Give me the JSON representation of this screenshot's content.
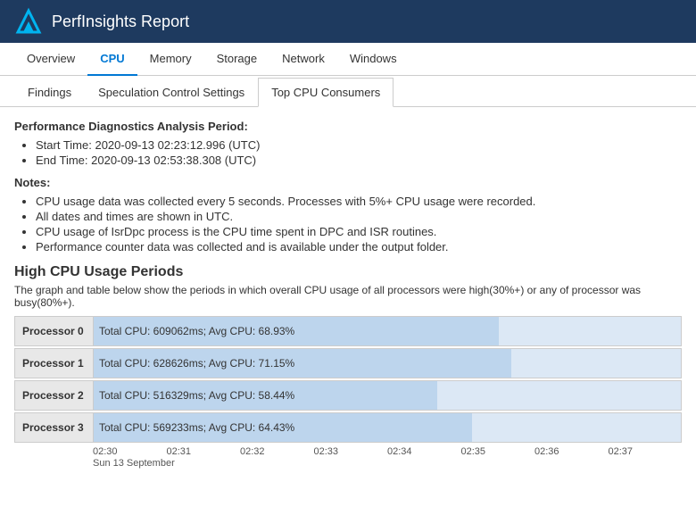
{
  "header": {
    "title": "PerfInsights Report"
  },
  "tabs1": {
    "items": [
      "Overview",
      "CPU",
      "Memory",
      "Storage",
      "Network",
      "Windows"
    ],
    "active": "CPU"
  },
  "tabs2": {
    "items": [
      "Findings",
      "Speculation Control Settings",
      "Top CPU Consumers"
    ],
    "active": "Top CPU Consumers"
  },
  "analysis_period": {
    "label": "Performance Diagnostics Analysis Period:",
    "start": "Start Time: 2020-09-13 02:23:12.996 (UTC)",
    "end": "End Time: 2020-09-13 02:53:38.308 (UTC)"
  },
  "notes": {
    "label": "Notes:",
    "items": [
      "CPU usage data was collected every 5 seconds. Processes with 5%+ CPU usage were recorded.",
      "All dates and times are shown in UTC.",
      "CPU usage of IsrDpc process is the CPU time spent in DPC and ISR routines.",
      "Performance counter data was collected and is available under the output folder."
    ]
  },
  "high_cpu": {
    "title": "High CPU Usage Periods",
    "description": "The graph and table below show the periods in which overall CPU usage of all processors were high(30%+) or any of processor was busy(80%+).",
    "processors": [
      {
        "label": "Processor 0",
        "stats": "Total CPU: 609062ms; Avg CPU: 68.93%",
        "pct": 68.93
      },
      {
        "label": "Processor 1",
        "stats": "Total CPU: 628626ms; Avg CPU: 71.15%",
        "pct": 71.15
      },
      {
        "label": "Processor 2",
        "stats": "Total CPU: 516329ms; Avg CPU: 58.44%",
        "pct": 58.44
      },
      {
        "label": "Processor 3",
        "stats": "Total CPU: 569233ms; Avg CPU: 64.43%",
        "pct": 64.43
      }
    ],
    "time_ticks": [
      "02:30",
      "02:31",
      "02:32",
      "02:33",
      "02:34",
      "02:35",
      "02:36",
      "02:37"
    ],
    "time_date": "Sun 13 September"
  }
}
